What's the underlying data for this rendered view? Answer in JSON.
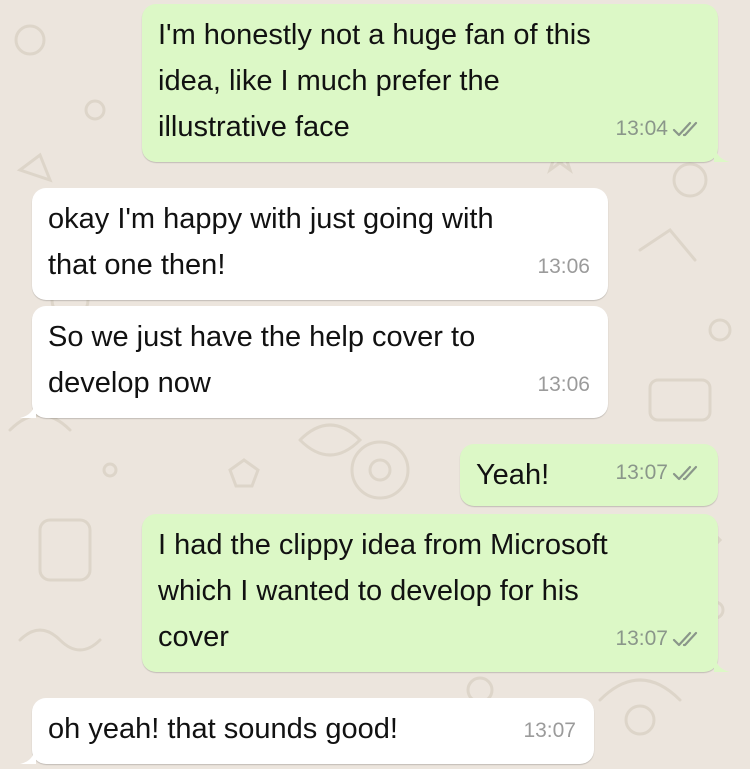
{
  "colors": {
    "background": "#ece5dd",
    "outgoing_bubble": "#dcf8c6",
    "incoming_bubble": "#ffffff",
    "timestamp": "#8a968a",
    "read_ticks": "#8a968a"
  },
  "messages": [
    {
      "direction": "outgoing",
      "text": "I'm honestly not a huge fan of this\nidea, like I much prefer the\nillustrative face",
      "time": "13:04",
      "status_icon": "double-check-icon"
    },
    {
      "direction": "incoming",
      "text": "okay I'm happy with just going with\nthat one then!",
      "time": "13:06"
    },
    {
      "direction": "incoming",
      "text": "So we just have the help cover to\ndevelop now",
      "time": "13:06"
    },
    {
      "direction": "outgoing",
      "text": "Yeah!",
      "time": "13:07",
      "status_icon": "double-check-icon"
    },
    {
      "direction": "outgoing",
      "text": "I had the clippy idea from Microsoft\nwhich I wanted to develop for his\ncover",
      "time": "13:07",
      "status_icon": "double-check-icon"
    },
    {
      "direction": "incoming",
      "text": "oh yeah! that sounds good!",
      "time": "13:07"
    }
  ]
}
